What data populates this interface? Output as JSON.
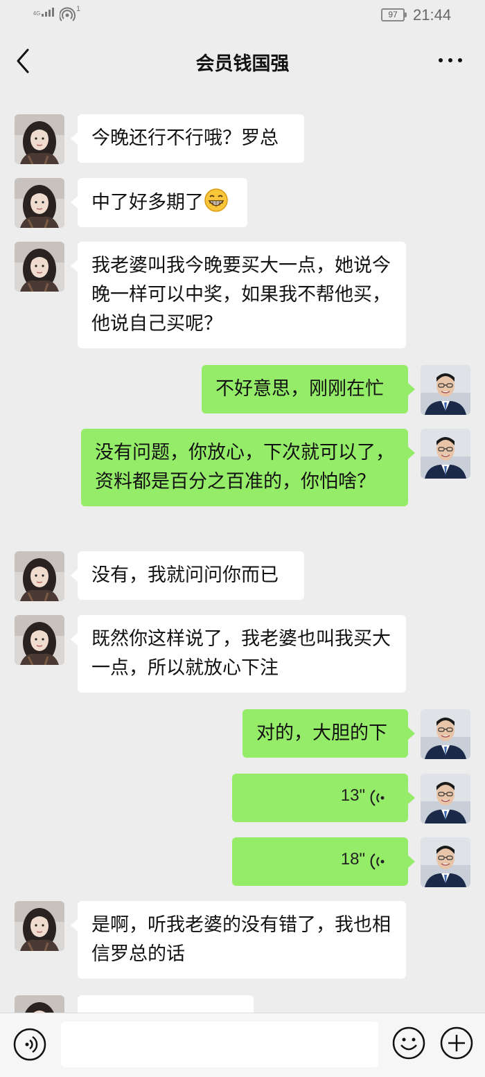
{
  "status_bar": {
    "network": "4G",
    "hotspot_count": "1",
    "battery": "97",
    "time": "21:44"
  },
  "header": {
    "title": "会员钱国强"
  },
  "messages": [
    {
      "side": "left",
      "text": "今晚还行不行哦？罗总"
    },
    {
      "side": "left",
      "text": "中了好多期了",
      "emoji": "grinning-face"
    },
    {
      "side": "left",
      "text": "我老婆叫我今晚要买大一点，她说今晚一样可以中奖，如果我不帮他买，他说自己买呢？"
    },
    {
      "side": "right",
      "text": "不好意思，刚刚在忙"
    },
    {
      "side": "right",
      "text": "没有问题，你放心，下次就可以了，资料都是百分之百准的，你怕啥？"
    },
    {
      "side": "left",
      "text": "没有，我就问问你而已"
    },
    {
      "side": "left",
      "text": "既然你这样说了，我老婆也叫我买大一点，所以就放心下注"
    },
    {
      "side": "right",
      "text": "对的，大胆的下"
    },
    {
      "side": "right",
      "type": "voice",
      "duration": "13\""
    },
    {
      "side": "right",
      "type": "voice",
      "duration": "18\""
    },
    {
      "side": "left",
      "text": "是啊，听我老婆的没有错了，我也相信罗总的话"
    }
  ],
  "input_bar": {
    "value": "",
    "placeholder": ""
  },
  "colors": {
    "background": "#ededed",
    "incoming_bubble": "#ffffff",
    "outgoing_bubble": "#95ec69"
  }
}
